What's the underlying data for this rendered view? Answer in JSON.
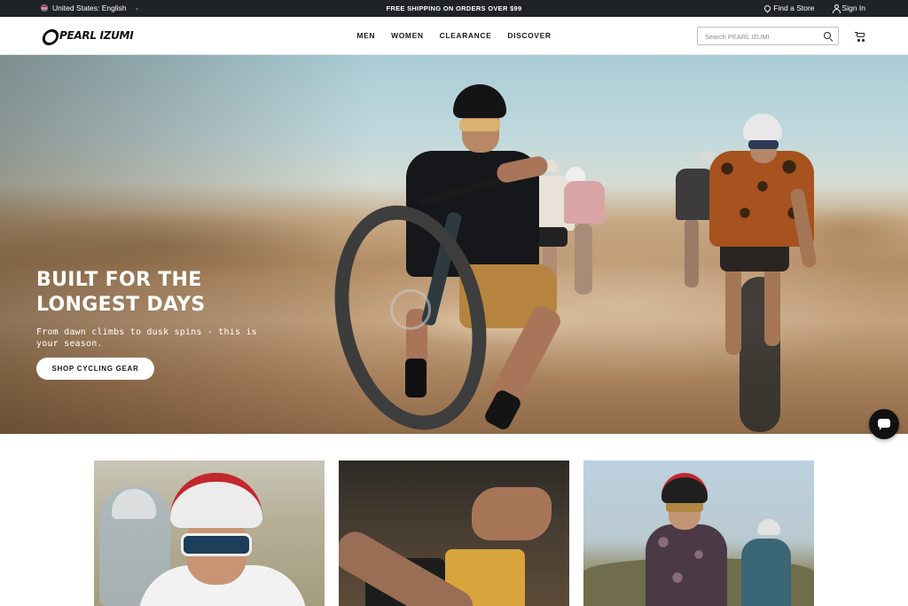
{
  "topbar": {
    "locale": "United States: English",
    "promo": "FREE SHIPPING ON ORDERS OVER $99",
    "find_store": "Find a Store",
    "sign_in": "Sign In"
  },
  "header": {
    "brand": "PEARL IZUMI",
    "nav": [
      "MEN",
      "WOMEN",
      "CLEARANCE",
      "DISCOVER"
    ],
    "search_placeholder": "Search PEARL IZUMI"
  },
  "hero": {
    "title": "BUILT FOR THE\nLONGEST DAYS",
    "subtitle": "From dawn climbs to dusk spins - this is your season.",
    "cta": "SHOP CYCLING GEAR"
  },
  "icons": {
    "flag": "us-flag-icon",
    "locale_caret": "chevron-down-icon",
    "store": "location-pin-icon",
    "account": "user-icon",
    "search": "search-icon",
    "cart": "cart-icon",
    "chat": "chat-icon"
  },
  "colors": {
    "topbar_bg": "#1f2328",
    "text_dark": "#1a1a1a",
    "white": "#ffffff"
  }
}
